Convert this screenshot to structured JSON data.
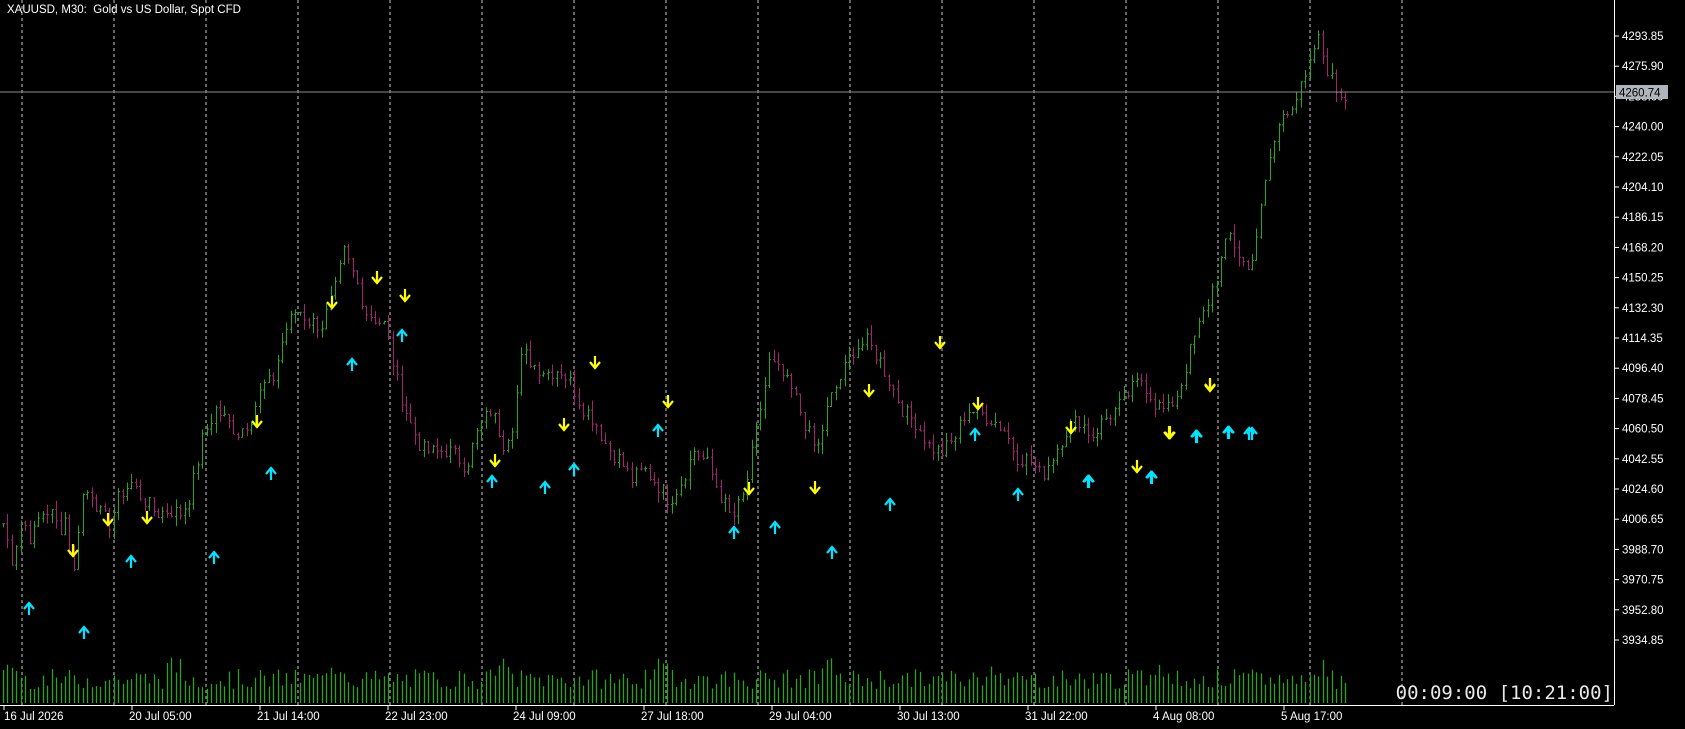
{
  "header": {
    "title": "XAUUSD, M30:  Gold vs US Dollar, Spot CFD"
  },
  "timer": {
    "text": "00:09:00 [10:21:00]"
  },
  "colors": {
    "background": "#000000",
    "bull": "#2aa31f",
    "bear": "#a3246e",
    "volume": "#2aa31f",
    "sell_arrow": "#ffff00",
    "buy_arrow": "#00e5ff",
    "grid": "#c8c8c8",
    "price_label_bg": "#b0b4bc"
  },
  "chart_data": {
    "type": "bar",
    "subtype": "ohlc-with-volume",
    "symbol": "XAUUSD",
    "timeframe": "M30",
    "title": "XAUUSD, M30:  Gold vs US Dollar, Spot CFD",
    "ylim": [
      3920,
      4305
    ],
    "y_ticks": [
      "4293.85",
      "4275.90",
      "4258.00",
      "4240.00",
      "4222.05",
      "4204.10",
      "4186.15",
      "4168.20",
      "4150.25",
      "4132.30",
      "4114.35",
      "4096.40",
      "4078.45",
      "4060.50",
      "4042.55",
      "4024.60",
      "4006.65",
      "3988.70",
      "3970.75",
      "3952.80",
      "3934.85"
    ],
    "current_price": "4260.74",
    "x_ticks": [
      "16 Jul 2026",
      "20 Jul 05:00",
      "21 Jul 14:00",
      "22 Jul 23:00",
      "24 Jul 09:00",
      "27 Jul 18:00",
      "29 Jul 04:00",
      "30 Jul 13:00",
      "31 Jul 22:00",
      "4 Aug 08:00",
      "5 Aug 17:00"
    ],
    "bar_count": 304,
    "price_path": [
      [
        0,
        4004
      ],
      [
        6,
        3982
      ],
      [
        12,
        4008
      ],
      [
        18,
        3994
      ],
      [
        24,
        4010
      ],
      [
        30,
        4012
      ],
      [
        36,
        4000
      ],
      [
        40,
        4008
      ],
      [
        45,
        3972
      ],
      [
        50,
        4020
      ],
      [
        56,
        4024
      ],
      [
        62,
        4010
      ],
      [
        68,
        4004
      ],
      [
        75,
        4022
      ],
      [
        82,
        4028
      ],
      [
        90,
        4018
      ],
      [
        98,
        4010
      ],
      [
        106,
        4012
      ],
      [
        114,
        4010
      ],
      [
        120,
        4022
      ],
      [
        128,
        4056
      ],
      [
        136,
        4072
      ],
      [
        144,
        4064
      ],
      [
        150,
        4058
      ],
      [
        158,
        4066
      ],
      [
        166,
        4086
      ],
      [
        172,
        4088
      ],
      [
        180,
        4118
      ],
      [
        188,
        4132
      ],
      [
        196,
        4124
      ],
      [
        204,
        4122
      ],
      [
        212,
        4142
      ],
      [
        218,
        4165
      ],
      [
        226,
        4148
      ],
      [
        232,
        4130
      ],
      [
        238,
        4126
      ],
      [
        244,
        4122
      ],
      [
        252,
        4088
      ],
      [
        260,
        4064
      ],
      [
        268,
        4048
      ],
      [
        276,
        4046
      ],
      [
        284,
        4048
      ],
      [
        290,
        4044
      ],
      [
        296,
        4038
      ],
      [
        304,
        4060
      ],
      [
        312,
        4072
      ],
      [
        320,
        4052
      ],
      [
        326,
        4064
      ],
      [
        332,
        4106
      ],
      [
        340,
        4098
      ],
      [
        348,
        4094
      ],
      [
        356,
        4096
      ],
      [
        364,
        4086
      ],
      [
        370,
        4074
      ],
      [
        378,
        4066
      ],
      [
        386,
        4050
      ],
      [
        394,
        4042
      ],
      [
        402,
        4030
      ],
      [
        410,
        4036
      ],
      [
        418,
        4028
      ],
      [
        426,
        4018
      ],
      [
        434,
        4030
      ],
      [
        442,
        4048
      ],
      [
        450,
        4040
      ],
      [
        458,
        4022
      ],
      [
        466,
        4006
      ],
      [
        474,
        4022
      ],
      [
        482,
        4062
      ],
      [
        490,
        4100
      ],
      [
        498,
        4092
      ],
      [
        506,
        4080
      ],
      [
        514,
        4060
      ],
      [
        520,
        4046
      ],
      [
        528,
        4076
      ],
      [
        536,
        4092
      ],
      [
        544,
        4108
      ],
      [
        552,
        4112
      ],
      [
        560,
        4102
      ],
      [
        568,
        4086
      ],
      [
        576,
        4070
      ],
      [
        584,
        4064
      ],
      [
        592,
        4050
      ],
      [
        600,
        4046
      ],
      [
        608,
        4054
      ],
      [
        616,
        4072
      ],
      [
        624,
        4070
      ],
      [
        632,
        4066
      ],
      [
        640,
        4060
      ],
      [
        648,
        4044
      ],
      [
        656,
        4042
      ],
      [
        664,
        4032
      ],
      [
        672,
        4046
      ],
      [
        680,
        4060
      ],
      [
        688,
        4066
      ],
      [
        696,
        4056
      ],
      [
        704,
        4066
      ],
      [
        712,
        4072
      ],
      [
        720,
        4082
      ],
      [
        728,
        4090
      ],
      [
        736,
        4076
      ],
      [
        744,
        4070
      ],
      [
        752,
        4084
      ],
      [
        760,
        4110
      ],
      [
        768,
        4130
      ],
      [
        776,
        4152
      ],
      [
        784,
        4176
      ],
      [
        790,
        4164
      ],
      [
        796,
        4154
      ],
      [
        802,
        4178
      ],
      [
        810,
        4222
      ],
      [
        818,
        4248
      ],
      [
        826,
        4256
      ],
      [
        834,
        4270
      ],
      [
        840,
        4294
      ],
      [
        846,
        4276
      ],
      [
        852,
        4262
      ],
      [
        858,
        4258
      ]
    ],
    "sell_signals": 22,
    "buy_signals": 27,
    "volume_range": [
      3920,
      3956
    ]
  }
}
